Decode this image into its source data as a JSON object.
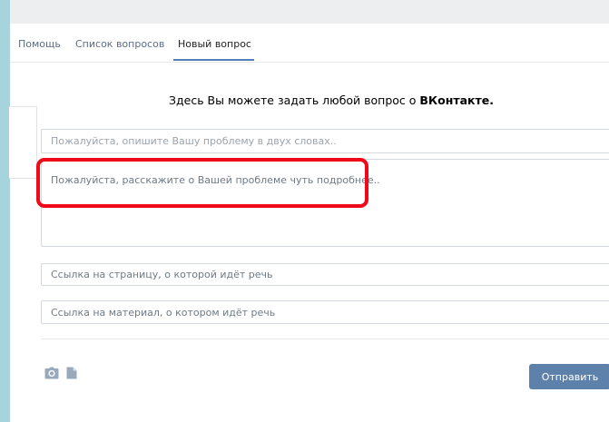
{
  "tabs": [
    {
      "label": "Помощь",
      "active": false
    },
    {
      "label": "Список вопросов",
      "active": false
    },
    {
      "label": "Новый вопрос",
      "active": true
    }
  ],
  "intro": {
    "text": "Здесь Вы можете задать любой вопрос о ",
    "brand": "ВКонтакте."
  },
  "form": {
    "title_placeholder": "Пожалуйста, опишите Вашу проблему в двух словах..",
    "body_placeholder": "Пожалуйста, расскажите о Вашей проблеме чуть подробнее..",
    "page_link_placeholder": "Ссылка на страницу, о которой идёт речь",
    "material_link_placeholder": "Ссылка на материал, о котором идёт речь",
    "submit_label": "Отправить"
  },
  "icons": {
    "photo": "camera-icon",
    "document": "document-icon"
  },
  "colors": {
    "accent": "#5181b8",
    "button": "#5d81ab",
    "highlight": "#ef0a1a",
    "tab_link": "#5b6e85"
  }
}
